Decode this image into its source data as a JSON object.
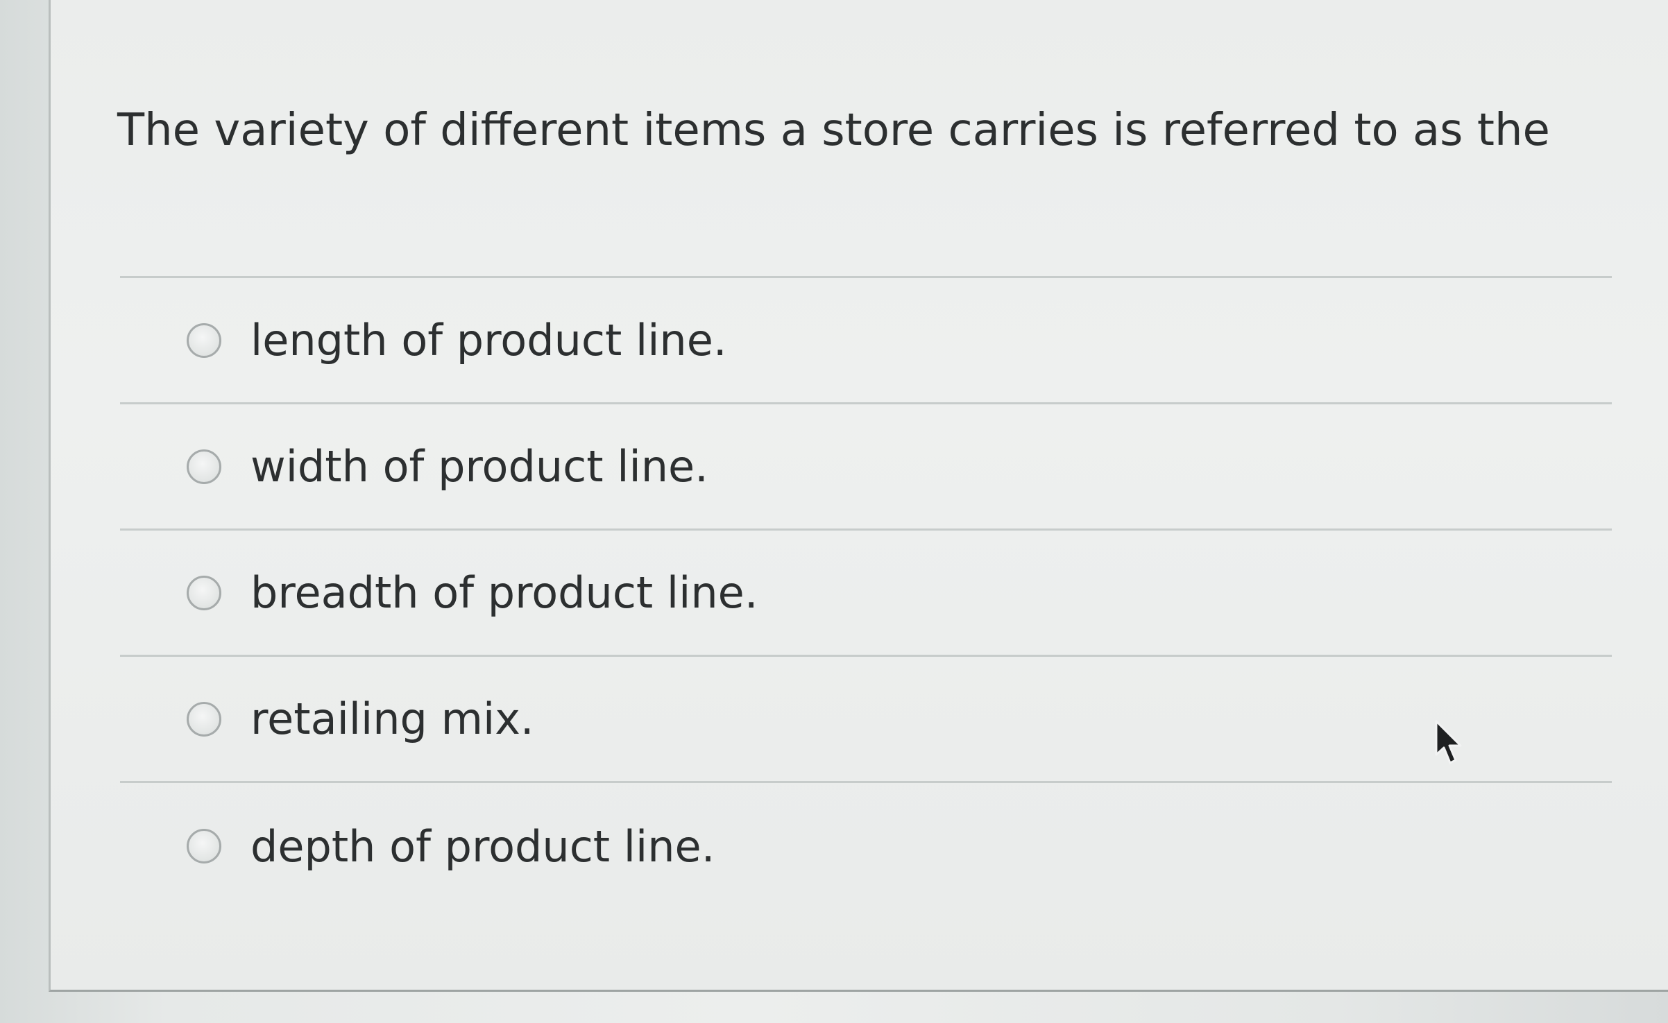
{
  "question": {
    "text": "The variety of different items a store carries is referred to as the"
  },
  "options": [
    {
      "label": "length of product line.",
      "selected": false
    },
    {
      "label": "width of product line.",
      "selected": false
    },
    {
      "label": "breadth of product line.",
      "selected": false
    },
    {
      "label": "retailing mix.",
      "selected": false
    },
    {
      "label": "depth of product line.",
      "selected": false
    }
  ],
  "icons": {
    "radio": "radio-button-icon",
    "cursor": "mouse-pointer-icon"
  },
  "colors": {
    "text": "#2c2f30",
    "divider": "#c7cccb",
    "card_background": "#eceeed"
  }
}
